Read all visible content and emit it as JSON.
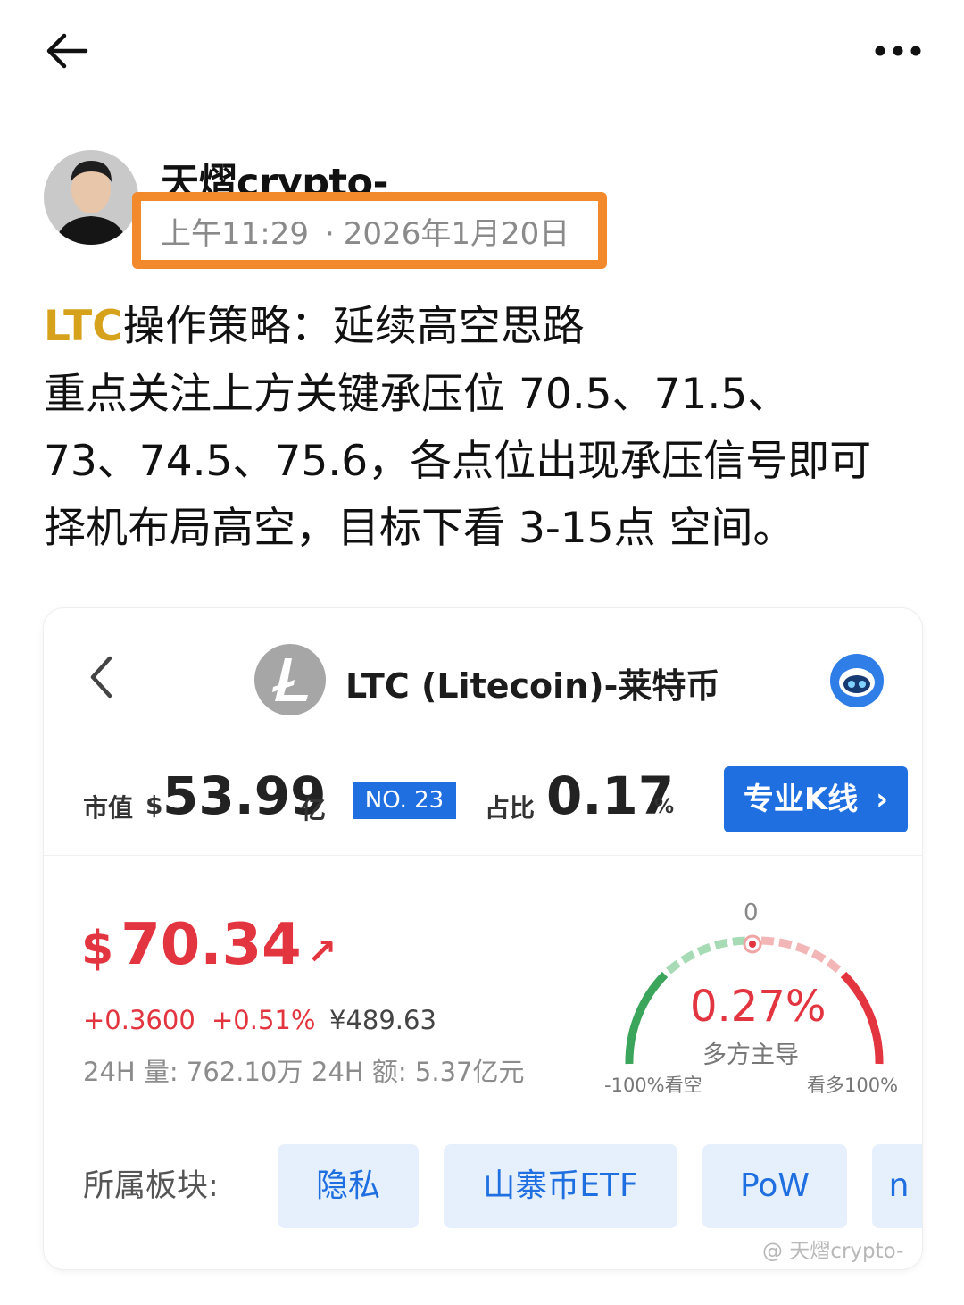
{
  "topbar": {
    "back_icon": "arrow-left-icon",
    "more_icon": "more-dots-icon"
  },
  "author": {
    "name": "天熠crypto-",
    "time": "上午11:29",
    "date": "2026年1月20日",
    "separator": "·"
  },
  "post": {
    "ticker": "LTC",
    "line1_rest": "操作策略：延续高空思路",
    "line2": "重点关注上方关键承压位 70.5、71.5、",
    "line3": "73、74.5、75.6，各点位出现承压信号即可",
    "line4": "择机布局高空，目标下看 3-15点 空间。"
  },
  "card": {
    "title": "LTC (Litecoin)-莱特币",
    "market_cap_label": "市值",
    "market_cap_currency": "$",
    "market_cap_value": "53.99",
    "market_cap_unit": "亿",
    "rank": "NO. 23",
    "share_label": "占比",
    "share_value": "0.17",
    "share_unit": "%",
    "kline_button": "专业K线",
    "kline_chevron": "›",
    "price_currency": "$",
    "price": "70.34",
    "price_arrow": "↗",
    "change_abs": "+0.3600",
    "change_pct": "+0.51%",
    "price_cny": "¥489.63",
    "volume_label": "24H 量: 762.10万",
    "turnover_label": "24H 额: 5.37亿元",
    "gauge": {
      "top_label": "0",
      "percent": "0.27%",
      "description": "多方主导",
      "left_label": "-100%看空",
      "right_label": "看多100%",
      "value_pct": 0.27
    },
    "sector_label": "所属板块:",
    "sectors": [
      "隐私",
      "山寨币ETF",
      "PoW",
      "n"
    ],
    "watermark": "@ 天熠crypto-"
  },
  "colors": {
    "orange_highlight": "#f28a2c",
    "accent_blue": "#1f6fe0",
    "price_red": "#e3353f",
    "ticker_gold": "#d6a21c"
  }
}
